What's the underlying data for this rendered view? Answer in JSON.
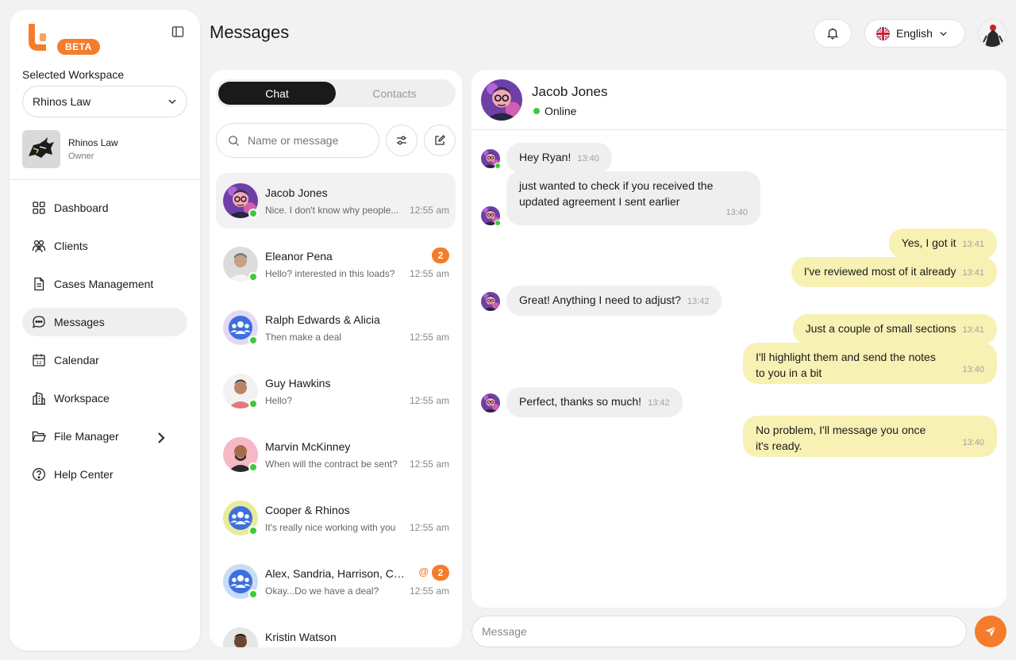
{
  "brand": {
    "badge": "BETA",
    "accent": "#f57c2b"
  },
  "workspace": {
    "label": "Selected Workspace",
    "selected": "Rhinos Law",
    "card_name": "Rhinos Law",
    "card_role": "Owner"
  },
  "nav": {
    "items": [
      {
        "label": "Dashboard",
        "icon": "grid-icon"
      },
      {
        "label": "Clients",
        "icon": "users-icon"
      },
      {
        "label": "Cases Management",
        "icon": "document-icon"
      },
      {
        "label": "Messages",
        "icon": "chat-bubble-icon",
        "active": true
      },
      {
        "label": "Calendar",
        "icon": "calendar-icon"
      },
      {
        "label": "Workspace",
        "icon": "building-icon"
      },
      {
        "label": "File Manager",
        "icon": "folder-icon"
      },
      {
        "label": "Help Center",
        "icon": "help-icon"
      }
    ]
  },
  "header": {
    "title": "Messages",
    "language": "English"
  },
  "list": {
    "tabs": [
      "Chat",
      "Contacts"
    ],
    "search_placeholder": "Name or message",
    "conversations": [
      {
        "name": "Jacob Jones",
        "preview": "Nice. I don't know why people...",
        "time": "12:55 am",
        "online": true,
        "active": true,
        "avatar": "cartoon"
      },
      {
        "name": "Eleanor Pena",
        "preview": "Hello? interested in this loads?",
        "time": "12:55 am",
        "online": true,
        "badge": "2",
        "avatar": "person-gray"
      },
      {
        "name": "Ralph Edwards & Alicia",
        "preview": "Then make a deal",
        "time": "12:55 am",
        "online": true,
        "avatar": "group-purple"
      },
      {
        "name": "Guy Hawkins",
        "preview": "Hello?",
        "time": "12:55 am",
        "online": true,
        "avatar": "person-light"
      },
      {
        "name": "Marvin McKinney",
        "preview": "When will the contract be sent?",
        "time": "12:55 am",
        "online": true,
        "avatar": "person-pink"
      },
      {
        "name": "Cooper & Rhinos",
        "preview": "It's really nice working with you",
        "time": "12:55 am",
        "online": true,
        "avatar": "group-yellow"
      },
      {
        "name": "Alex, Sandria, Harrison, Cooper",
        "preview": "Okay...Do we have a deal?",
        "time": "12:55 am",
        "online": true,
        "badge": "2",
        "mention": "@",
        "avatar": "group-blue"
      },
      {
        "name": "Kristin Watson",
        "preview": "",
        "time": "",
        "online": false,
        "avatar": "person-dark"
      }
    ]
  },
  "chat": {
    "contact_name": "Jacob Jones",
    "status": "Online",
    "composer_placeholder": "Message",
    "messages": [
      {
        "dir": "in",
        "text": "Hey Ryan!",
        "time": "13:40"
      },
      {
        "dir": "in",
        "text": "just wanted to check if you received the updated agreement I sent earlier",
        "time": "13:40"
      },
      {
        "dir": "out",
        "text": "Yes, I got it",
        "time": "13:41"
      },
      {
        "dir": "out",
        "text": "I've reviewed most of it already",
        "time": "13:41"
      },
      {
        "dir": "in",
        "text": "Great! Anything I need to adjust?",
        "time": "13:42"
      },
      {
        "dir": "out",
        "text": "Just a couple of small sections",
        "time": "13:41"
      },
      {
        "dir": "out",
        "text": "I'll highlight them and send the notes to you in a bit",
        "time": "13:40"
      },
      {
        "dir": "in",
        "text": "Perfect, thanks so much!",
        "time": "13:42"
      },
      {
        "dir": "out",
        "text": "No problem, I'll message you once it's ready.",
        "time": "13:40"
      }
    ]
  }
}
